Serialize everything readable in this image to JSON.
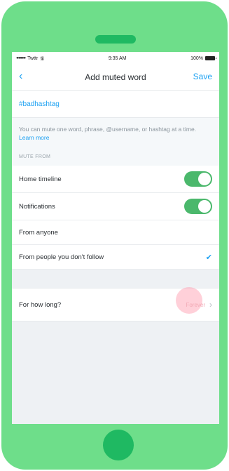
{
  "status_bar": {
    "carrier": "Twttr",
    "time": "9:35 AM",
    "battery": "100%"
  },
  "nav": {
    "back_glyph": "‹",
    "title": "Add muted word",
    "save_label": "Save"
  },
  "word_field": {
    "value": "#badhashtag"
  },
  "help": {
    "text": "You can mute one word, phrase, @username, or hashtag at a time. ",
    "link": "Learn more"
  },
  "mute_from": {
    "header": "MUTE FROM",
    "home_timeline": {
      "label": "Home timeline",
      "on": true
    },
    "notifications": {
      "label": "Notifications",
      "on": true
    },
    "from_anyone": {
      "label": "From anyone"
    },
    "from_people": {
      "label": "From people you don't follow",
      "selected": true
    }
  },
  "duration": {
    "label": "For how long?",
    "value": "Forever"
  },
  "colors": {
    "accent": "#1da1f2",
    "toggle_on": "#4bb86c",
    "phone_body": "#6ede8a",
    "phone_detail": "#1fb962"
  }
}
